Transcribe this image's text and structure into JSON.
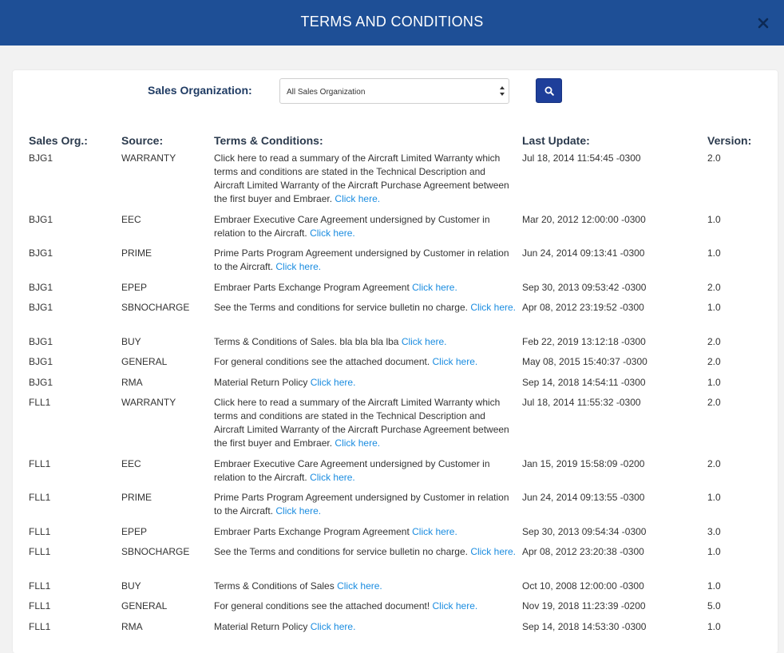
{
  "header": {
    "title": "TERMS AND CONDITIONS"
  },
  "filter": {
    "label": "Sales Organization:",
    "selected": "All Sales Organization"
  },
  "table": {
    "columns": [
      "Sales Org.:",
      "Source:",
      "Terms & Conditions:",
      "Last Update:",
      "Version:"
    ],
    "rows": [
      {
        "org": "BJG1",
        "source": "WARRANTY",
        "text": "Click here to read a summary of the Aircraft Limited Warranty which terms and conditions are stated in the Technical Description and Aircraft Limited Warranty of the Aircraft Purchase Agreement between the first buyer and Embraer.",
        "link": "Click here.",
        "date": "Jul 18, 2014 11:54:45 -0300",
        "version": "2.0"
      },
      {
        "org": "BJG1",
        "source": "EEC",
        "text": "Embraer Executive Care Agreement undersigned by Customer in relation to the Aircraft.",
        "link": "Click here.",
        "date": "Mar 20, 2012 12:00:00 -0300",
        "version": "1.0"
      },
      {
        "org": "BJG1",
        "source": "PRIME",
        "text": "Prime Parts Program Agreement undersigned by Customer in relation to the Aircraft.",
        "link": "Click here.",
        "date": "Jun 24, 2014 09:13:41 -0300",
        "version": "1.0"
      },
      {
        "org": "BJG1",
        "source": "EPEP",
        "text": "Embraer Parts Exchange Program Agreement",
        "link": "Click here.",
        "date": "Sep 30, 2013 09:53:42 -0300",
        "version": "2.0"
      },
      {
        "org": "BJG1",
        "source": "SBNOCHARGE",
        "text": "See the Terms and conditions for service bulletin no charge.",
        "link": "Click here.",
        "date": "Apr 08, 2012 23:19:52 -0300",
        "version": "1.0"
      },
      {
        "org": "BJG1",
        "source": "BUY",
        "text": "Terms & Conditions of Sales. bla bla bla lba",
        "link": "Click here.",
        "date": "Feb 22, 2019 13:12:18 -0300",
        "version": "2.0"
      },
      {
        "org": "BJG1",
        "source": "GENERAL",
        "text": "For general conditions see the attached document.",
        "link": "Click here.",
        "date": "May 08, 2015 15:40:37 -0300",
        "version": "2.0"
      },
      {
        "org": "BJG1",
        "source": "RMA",
        "text": "Material Return Policy",
        "link": "Click here.",
        "date": "Sep 14, 2018 14:54:11 -0300",
        "version": "1.0"
      },
      {
        "org": "FLL1",
        "source": "WARRANTY",
        "text": "Click here to read a summary of the Aircraft Limited Warranty which terms and conditions are stated in the Technical Description and Aircraft Limited Warranty of the Aircraft Purchase Agreement between the first buyer and Embraer.",
        "link": "Click here.",
        "date": "Jul 18, 2014 11:55:32 -0300",
        "version": "2.0"
      },
      {
        "org": "FLL1",
        "source": "EEC",
        "text": "Embraer Executive Care Agreement undersigned by Customer in relation to the Aircraft.",
        "link": "Click here.",
        "date": "Jan 15, 2019 15:58:09 -0200",
        "version": "2.0"
      },
      {
        "org": "FLL1",
        "source": "PRIME",
        "text": "Prime Parts Program Agreement undersigned by Customer in relation to the Aircraft.",
        "link": "Click here.",
        "date": "Jun 24, 2014 09:13:55 -0300",
        "version": "1.0"
      },
      {
        "org": "FLL1",
        "source": "EPEP",
        "text": "Embraer Parts Exchange Program Agreement",
        "link": "Click here.",
        "date": "Sep 30, 2013 09:54:34 -0300",
        "version": "3.0"
      },
      {
        "org": "FLL1",
        "source": "SBNOCHARGE",
        "text": "See the Terms and conditions for service bulletin no charge.",
        "link": "Click here.",
        "date": "Apr 08, 2012 23:20:38 -0300",
        "version": "1.0"
      },
      {
        "org": "FLL1",
        "source": "BUY",
        "text": "Terms & Conditions of Sales",
        "link": "Click here.",
        "date": "Oct 10, 2008 12:00:00 -0300",
        "version": "1.0"
      },
      {
        "org": "FLL1",
        "source": "GENERAL",
        "text": "For general conditions see the attached document!",
        "link": "Click here.",
        "date": "Nov 19, 2018 11:23:39 -0200",
        "version": "5.0"
      },
      {
        "org": "FLL1",
        "source": "RMA",
        "text": "Material Return Policy",
        "link": "Click here.",
        "date": "Sep 14, 2018 14:53:30 -0300",
        "version": "1.0"
      }
    ]
  }
}
